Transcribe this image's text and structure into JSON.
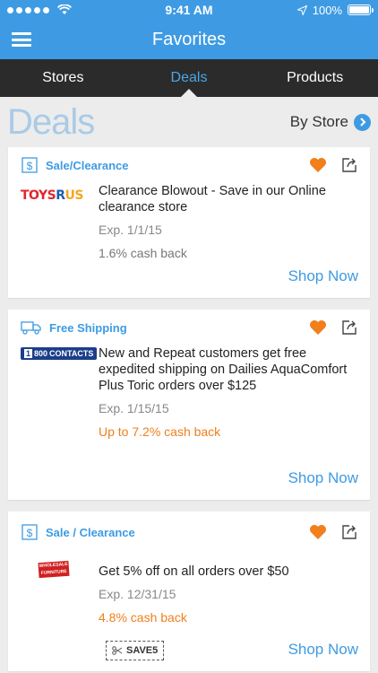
{
  "status": {
    "time": "9:41 AM",
    "battery": "100%",
    "battery_fraction": 1.0
  },
  "header": {
    "title": "Favorites"
  },
  "tabs": [
    {
      "label": "Stores",
      "active": false
    },
    {
      "label": "Deals",
      "active": true
    },
    {
      "label": "Products",
      "active": false
    }
  ],
  "section": {
    "title": "Deals",
    "by_store": "By Store"
  },
  "colors": {
    "accent": "#3e9be3",
    "orange": "#f07f1c",
    "tabbar": "#2b2b2b"
  },
  "deals": [
    {
      "type_label": "Sale/Clearance",
      "type_icon": "dollar-icon",
      "store": "Toys R Us",
      "logo_parts": [
        "TOYS",
        "R",
        "US"
      ],
      "description": "Clearance Blowout - Save in our Online clearance store",
      "expiry": "Exp. 1/1/15",
      "cash_back": "1.6% cash back",
      "cash_back_highlight": false,
      "shop_now": "Shop Now"
    },
    {
      "type_label": "Free Shipping",
      "type_icon": "truck-icon",
      "store": "1-800 Contacts",
      "logo_parts": [
        "1",
        "800",
        "CONTACTS"
      ],
      "description": "New and Repeat customers get free expedited shipping on Dailies AquaComfort Plus Toric orders over $125",
      "expiry": "Exp. 1/15/15",
      "cash_back": "Up to 7.2% cash back",
      "cash_back_highlight": true,
      "shop_now": "Shop Now"
    },
    {
      "type_label": "Sale / Clearance",
      "type_icon": "dollar-icon",
      "store": "Wholesale",
      "logo_parts": [
        "WHOLESALE",
        "FURNITURE CLUB"
      ],
      "description": "Get 5% off on all orders over $50",
      "expiry": "Exp. 12/31/15",
      "cash_back": "4.8% cash back",
      "cash_back_highlight": true,
      "coupon_code": "SAVE5",
      "shop_now": "Shop Now"
    }
  ]
}
